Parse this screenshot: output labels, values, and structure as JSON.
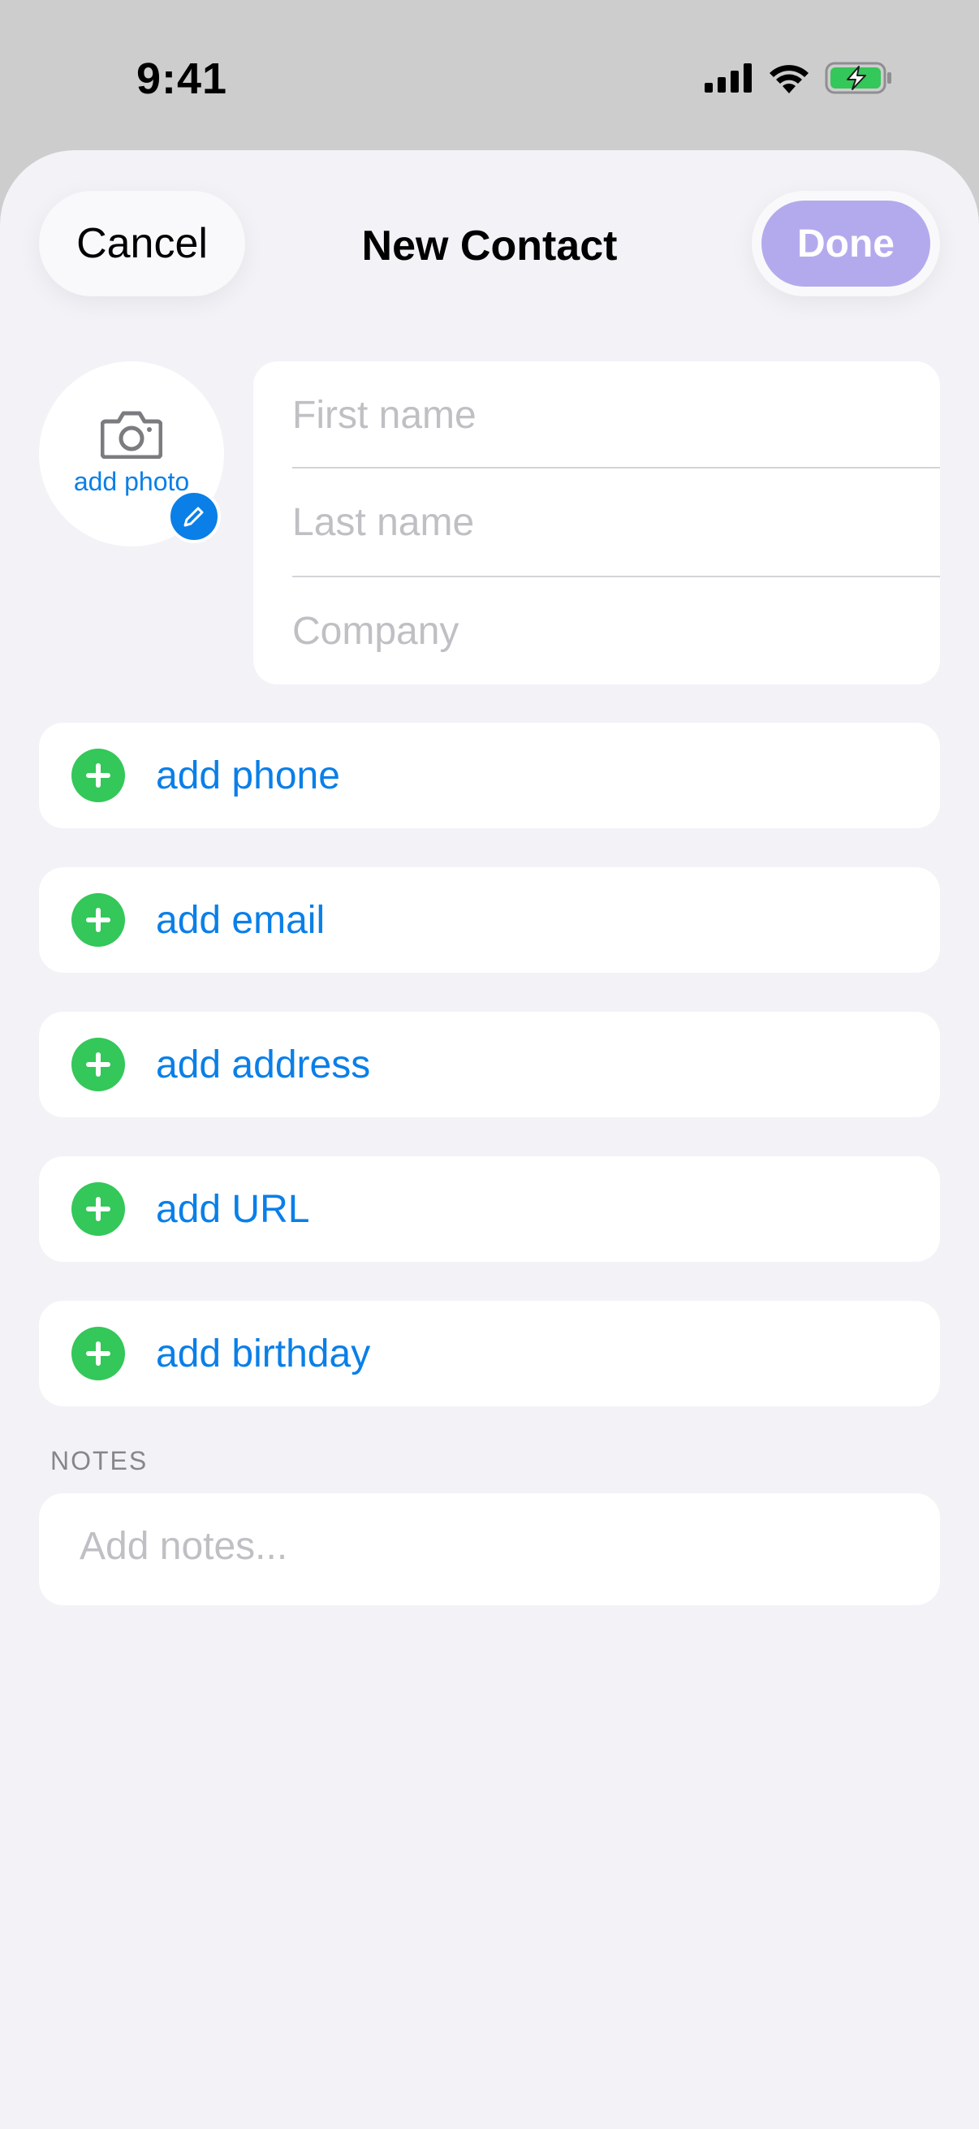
{
  "status_bar": {
    "time": "9:41",
    "icons": [
      "cellular-signal-icon",
      "wifi-icon",
      "battery-charging-icon"
    ]
  },
  "nav": {
    "cancel_label": "Cancel",
    "title": "New Contact",
    "done_label": "Done"
  },
  "photo": {
    "label": "add photo",
    "icon": "camera-icon",
    "edit_icon": "pencil-icon"
  },
  "name_fields": {
    "first_placeholder": "First name",
    "last_placeholder": "Last name",
    "company_placeholder": "Company"
  },
  "add_rows": [
    {
      "label": "add phone"
    },
    {
      "label": "add email"
    },
    {
      "label": "add address"
    },
    {
      "label": "add URL"
    },
    {
      "label": "add birthday"
    }
  ],
  "notes": {
    "header": "NOTES",
    "placeholder": "Add notes..."
  },
  "colors": {
    "accent": "#0a7fe8",
    "add_icon": "#34c759",
    "done_disabled": "#b3aaee",
    "sheet_background": "#f2f2f7"
  }
}
